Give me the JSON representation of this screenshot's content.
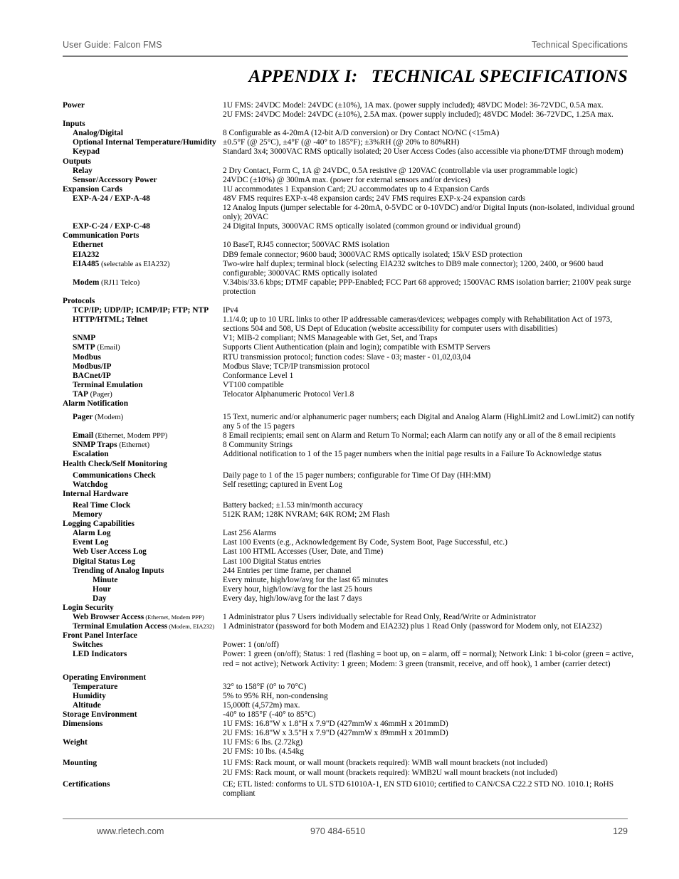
{
  "header": {
    "left": "User Guide: Falcon FMS",
    "right": "Technical Specifications"
  },
  "title": "APPENDIX I:   TECHNICAL SPECIFICATIONS",
  "footer": {
    "website": "www.rletech.com",
    "phone": "970 484-6510",
    "page_number": "129"
  },
  "spec_rows": [
    {
      "level": 0,
      "label": "Power",
      "qualifier": "",
      "values": [
        "1U FMS: 24VDC Model: 24VDC (±10%), 1A max. (power supply included); 48VDC Model: 36-72VDC, 0.5A max.",
        "2U FMS: 24VDC Model: 24VDC (±10%), 2.5A max. (power supply included); 48VDC Model: 36-72VDC, 1.25A max."
      ]
    },
    {
      "level": 0,
      "label": "Inputs",
      "qualifier": "",
      "values": []
    },
    {
      "level": 1,
      "label": "Analog/Digital",
      "qualifier": "",
      "values": [
        "8 Configurable as 4-20mA (12-bit A/D conversion) or Dry Contact NO/NC (<15mA)"
      ]
    },
    {
      "level": 1,
      "label": "Optional Internal Temperature/Humidity",
      "qualifier": "",
      "values": [
        "±0.5°F (@ 25°C), ±4°F (@ -40° to 185°F); ±3%RH (@ 20% to 80%RH)"
      ]
    },
    {
      "level": 1,
      "label": "Keypad",
      "qualifier": "",
      "values": [
        "Standard 3x4; 3000VAC RMS optically isolated; 20 User Access Codes (also accessible via phone/DTMF through modem)"
      ]
    },
    {
      "level": 0,
      "label": "Outputs",
      "qualifier": "",
      "values": []
    },
    {
      "level": 1,
      "label": "Relay",
      "qualifier": "",
      "values": [
        "2 Dry Contact, Form C, 1A @ 24VDC, 0.5A resistive @ 120VAC (controllable via user programmable logic)"
      ]
    },
    {
      "level": 1,
      "label": "Sensor/Accessory Power",
      "qualifier": "",
      "values": [
        "24VDC (±10%) @ 300mA max. (power for external sensors and/or devices)"
      ]
    },
    {
      "level": 0,
      "label": "Expansion Cards",
      "qualifier": "",
      "values": [
        "1U accommodates 1 Expansion Card; 2U accommodates up to 4 Expansion Cards"
      ]
    },
    {
      "level": 1,
      "label": "EXP-A-24 / EXP-A-48",
      "qualifier": "",
      "values": [
        "48V FMS requires EXP-x-48 expansion cards; 24V FMS requires EXP-x-24 expansion cards",
        "12 Analog Inputs (jumper selectable for 4-20mA, 0-5VDC or 0-10VDC) and/or Digital Inputs (non-isolated, individual ground only); 20VAC"
      ]
    },
    {
      "level": 1,
      "label": "EXP-C-24 / EXP-C-48",
      "qualifier": "",
      "values": [
        "24 Digital Inputs, 3000VAC RMS optically isolated (common ground or individual ground)"
      ]
    },
    {
      "level": 0,
      "label": "Communication Ports",
      "qualifier": "",
      "values": []
    },
    {
      "level": 1,
      "label": "Ethernet",
      "qualifier": "",
      "values": [
        "10 BaseT, RJ45 connector; 500VAC RMS isolation"
      ]
    },
    {
      "level": 1,
      "label": "EIA232",
      "qualifier": "",
      "values": [
        "DB9 female connector; 9600 baud; 3000VAC RMS optically isolated; 15kV ESD protection"
      ]
    },
    {
      "level": 1,
      "label": "EIA485",
      "qualifier": " (selectable as EIA232)",
      "values": [
        "Two-wire half duplex; terminal block (selecting EIA232 switches to DB9 male connector); 1200, 2400, or 9600 baud configurable; 3000VAC RMS optically isolated"
      ]
    },
    {
      "level": 1,
      "label": "Modem",
      "qualifier": " (RJ11 Telco)",
      "values": [
        "V.34bis/33.6 kbps; DTMF capable; PPP-Enabled; FCC Part 68 approved; 1500VAC RMS isolation barrier; 2100V peak surge protection"
      ]
    },
    {
      "level": 0,
      "label": "Protocols",
      "qualifier": "",
      "values": []
    },
    {
      "level": 1,
      "label": "TCP/IP; UDP/IP; ICMP/IP; FTP; NTP",
      "qualifier": "",
      "values": [
        "IPv4"
      ]
    },
    {
      "level": 1,
      "label": "HTTP/HTML; Telnet",
      "qualifier": "",
      "values": [
        "1.1/4.0; up to 10 URL links to other IP addressable cameras/devices; webpages comply with Rehabilitation Act of 1973, sections 504 and 508, US Dept of Education (website accessibility for computer users with disabilities)"
      ]
    },
    {
      "level": 1,
      "label": "SNMP",
      "qualifier": "",
      "values": [
        "V1; MIB-2 compliant; NMS Manageable with Get, Set, and Traps"
      ]
    },
    {
      "level": 1,
      "label": "SMTP",
      "qualifier": " (Email)",
      "values": [
        "Supports Client Authentication (plain and login); compatible with ESMTP Servers"
      ]
    },
    {
      "level": 1,
      "label": "Modbus",
      "qualifier": "",
      "values": [
        "RTU transmission protocol; function codes: Slave - 03; master - 01,02,03,04"
      ]
    },
    {
      "level": 1,
      "label": "Modbus/IP",
      "qualifier": "",
      "values": [
        "Modbus Slave; TCP/IP transmission protocol"
      ]
    },
    {
      "level": 1,
      "label": "BACnet/IP",
      "qualifier": "",
      "values": [
        "Conformance Level 1"
      ]
    },
    {
      "level": 1,
      "label": "Terminal Emulation",
      "qualifier": "",
      "values": [
        "VT100 compatible"
      ]
    },
    {
      "level": 1,
      "label": "TAP",
      "qualifier": " (Pager)",
      "values": [
        "Telocator Alphanumeric Protocol Ver1.8"
      ]
    },
    {
      "level": 0,
      "label": "Alarm Notification",
      "qualifier": "",
      "values": []
    },
    {
      "level": 1,
      "label": "Pager",
      "qualifier": " (Modem)",
      "values": [
        "15 Text, numeric and/or alphanumeric pager numbers; each Digital and Analog Alarm (HighLimit2 and LowLimit2) can notify any 5 of the 15 pagers"
      ],
      "gap": "large"
    },
    {
      "level": 1,
      "label": "Email",
      "qualifier": " (Ethernet, Modem PPP)",
      "values": [
        "8 Email recipients; email sent on Alarm and Return To Normal; each Alarm can notify any or all of the 8 email recipients"
      ]
    },
    {
      "level": 1,
      "label": "SNMP Traps",
      "qualifier": " (Ethernet)",
      "values": [
        "8 Community Strings"
      ]
    },
    {
      "level": 1,
      "label": "Escalation",
      "qualifier": "",
      "values": [
        "Additional notification to 1 of the 15 pager numbers when the initial page results in a Failure To Acknowledge status"
      ]
    },
    {
      "level": 0,
      "label": "Health Check/Self Monitoring",
      "qualifier": "",
      "values": []
    },
    {
      "level": 1,
      "label": "Communications Check",
      "qualifier": "",
      "values": [
        "Daily page to 1 of the 15 pager numbers; configurable for Time Of Day (HH:MM)"
      ],
      "gap": "small"
    },
    {
      "level": 1,
      "label": "Watchdog",
      "qualifier": "",
      "values": [
        "Self resetting; captured in Event Log"
      ]
    },
    {
      "level": 0,
      "label": "Internal Hardware",
      "qualifier": "",
      "values": []
    },
    {
      "level": 1,
      "label": "Real Time Clock",
      "qualifier": "",
      "values": [
        "Battery backed; ±1.53 min/month accuracy"
      ],
      "gap": "small"
    },
    {
      "level": 1,
      "label": "Memory",
      "qualifier": "",
      "values": [
        "512K RAM; 128K NVRAM; 64K ROM; 2M Flash"
      ]
    },
    {
      "level": 0,
      "label": "Logging Capabilities",
      "qualifier": "",
      "values": []
    },
    {
      "level": 1,
      "label": "Alarm Log",
      "qualifier": "",
      "values": [
        "Last 256 Alarms"
      ]
    },
    {
      "level": 1,
      "label": "Event Log",
      "qualifier": "",
      "values": [
        "Last 100 Events (e.g., Acknowledgement By Code, System Boot, Page Successful, etc.)"
      ]
    },
    {
      "level": 1,
      "label": "Web User Access Log",
      "qualifier": "",
      "values": [
        "Last 100 HTML Accesses (User, Date, and Time)"
      ]
    },
    {
      "level": 1,
      "label": "Digital Status Log",
      "qualifier": "",
      "values": [
        "Last 100 Digital Status entries"
      ]
    },
    {
      "level": 1,
      "label": "Trending of Analog Inputs",
      "qualifier": "",
      "values": [
        "244 Entries per time frame, per channel"
      ]
    },
    {
      "level": 2,
      "label": "Minute",
      "qualifier": "",
      "values": [
        "Every minute, high/low/avg for the last 65 minutes"
      ]
    },
    {
      "level": 2,
      "label": "Hour",
      "qualifier": "",
      "values": [
        "Every hour, high/low/avg for the last 25 hours"
      ]
    },
    {
      "level": 2,
      "label": "Day",
      "qualifier": "",
      "values": [
        "Every day, high/low/avg for the last 7 days"
      ]
    },
    {
      "level": 0,
      "label": "Login Security",
      "qualifier": "",
      "values": []
    },
    {
      "level": 1,
      "label": "Web Browser Access",
      "qualifier_small": " (Ethernet, Modem PPP)",
      "values": [
        "1 Administrator plus 7 Users individually selectable for Read Only, Read/Write or Administrator"
      ]
    },
    {
      "level": 1,
      "label": "Terminal Emulation Access",
      "qualifier_small": " (Modem, EIA232)",
      "values": [
        "1 Administrator (password for both Modem and EIA232) plus 1 Read Only (password for Modem only, not EIA232)"
      ]
    },
    {
      "level": 0,
      "label": "Front Panel Interface",
      "qualifier": "",
      "values": []
    },
    {
      "level": 1,
      "label": "Switches",
      "qualifier": "",
      "values": [
        "Power: 1 (on/off)"
      ]
    },
    {
      "level": 1,
      "label": "LED Indicators",
      "qualifier": "",
      "values": [
        "Power: 1 green (on/off); Status: 1 red (flashing = boot up, on = alarm, off = normal); Network Link: 1 bi-color (green = active, red = not active); Network Activity: 1 green; Modem: 3 green (transmit, receive, and off hook), 1 amber (carrier detect)"
      ]
    },
    {
      "level": 0,
      "label": "Operating Environment",
      "qualifier": "",
      "values": [],
      "gap": "large"
    },
    {
      "level": 1,
      "label": "Temperature",
      "qualifier": "",
      "values": [
        "32° to 158°F (0° to 70°C)"
      ]
    },
    {
      "level": 1,
      "label": "Humidity",
      "qualifier": "",
      "values": [
        "5% to 95% RH, non-condensing"
      ]
    },
    {
      "level": 1,
      "label": "Altitude",
      "qualifier": "",
      "values": [
        "15,000ft (4,572m) max."
      ]
    },
    {
      "level": 0,
      "label": "Storage Environment",
      "qualifier": "",
      "values": [
        "-40° to 185°F (-40° to 85°C)"
      ]
    },
    {
      "level": 0,
      "label": "Dimensions",
      "qualifier": "",
      "values": [
        "1U FMS: 16.8\"W x 1.8\"H x 7.9\"D (427mmW x 46mmH x 201mmD)",
        "2U FMS: 16.8\"W x 3.5\"H x 7.9\"D (427mmW x 89mmH x 201mmD)"
      ]
    },
    {
      "level": 0,
      "label": "Weight",
      "qualifier": "",
      "values": [
        "1U FMS: 6 lbs. (2.72kg)",
        "2U FMS: 10 lbs. (4.54kg"
      ]
    },
    {
      "level": 0,
      "label": "Mounting",
      "qualifier": "",
      "values": [
        "1U FMS: Rack mount, or wall mount (brackets required): WMB wall mount brackets (not included)",
        "2U FMS: Rack mount, or wall mount (brackets required): WMB2U wall mount brackets (not included)"
      ],
      "gap": "small"
    },
    {
      "level": 0,
      "label": "Certifications",
      "qualifier": "",
      "values": [
        "CE; ETL listed: conforms to UL STD 61010A-1, EN STD 61010; certified to CAN/CSA C22.2 STD NO. 1010.1; RoHS compliant"
      ],
      "gap": "small"
    }
  ]
}
